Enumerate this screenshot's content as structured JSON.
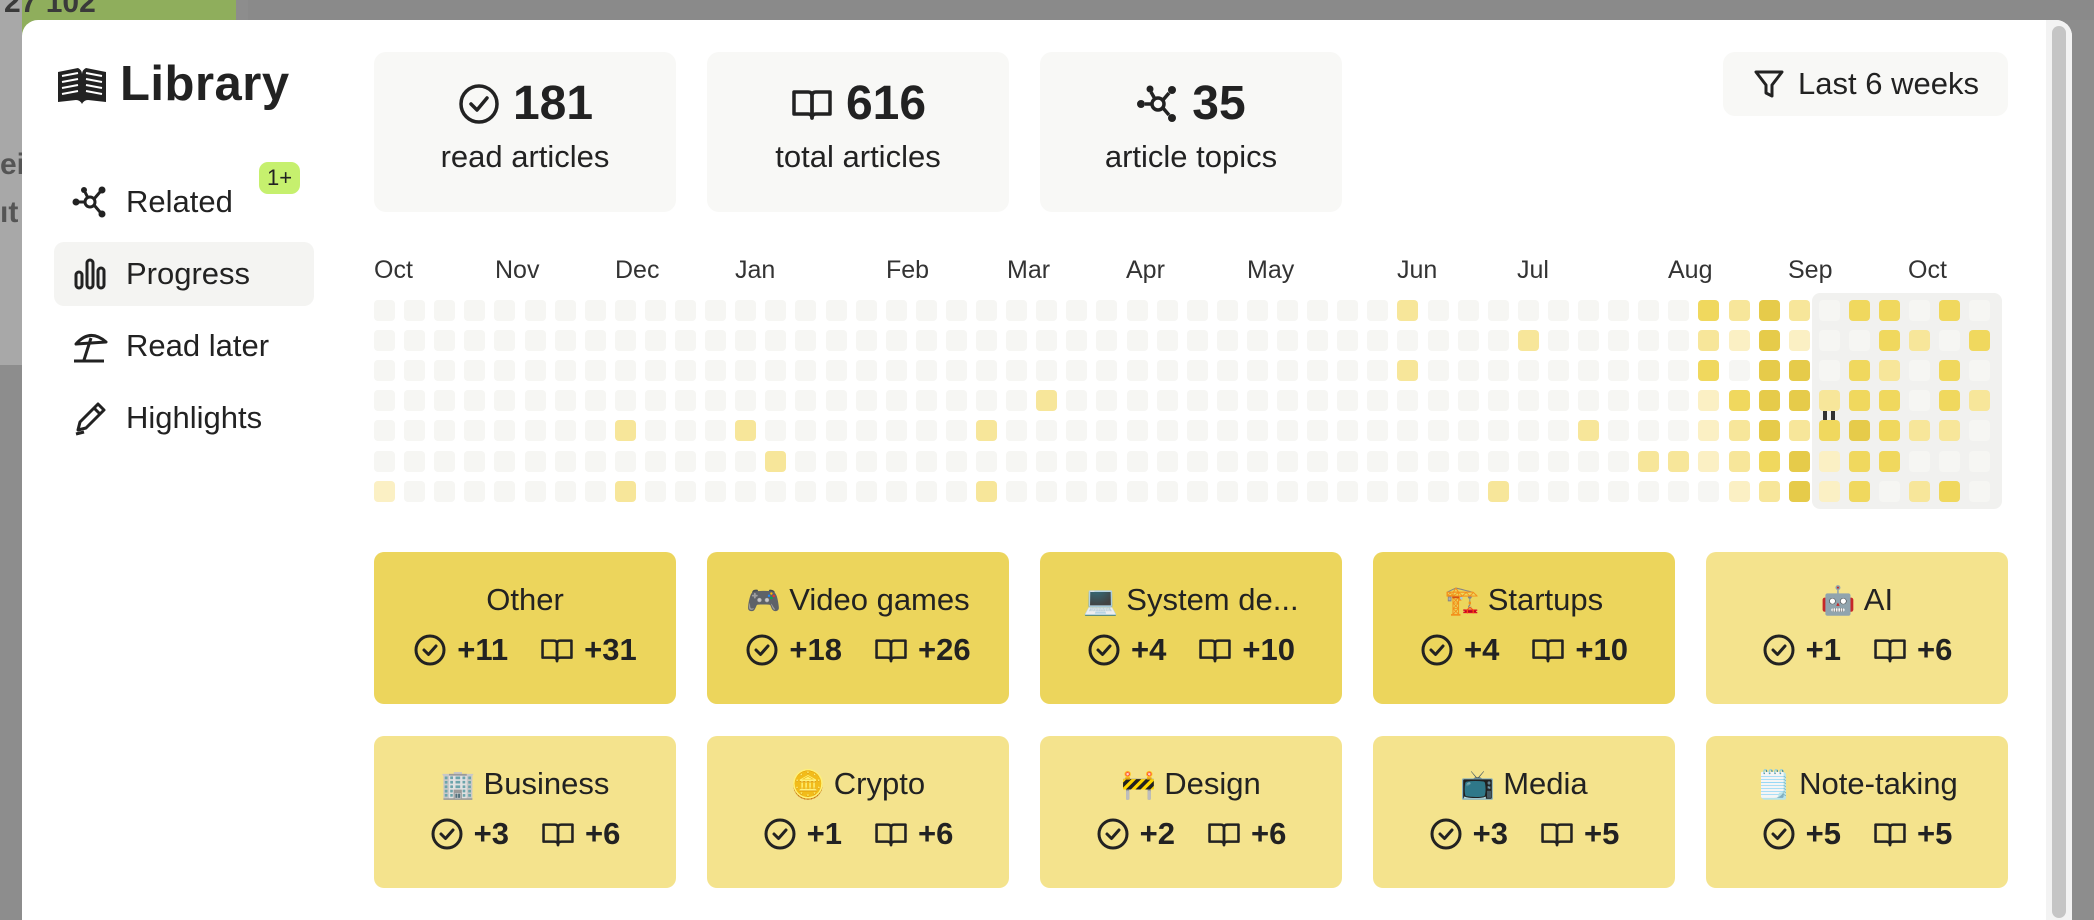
{
  "background": {
    "fragment_top": "27  102",
    "fragment_left_1": "ei",
    "fragment_left_2": "ıt"
  },
  "app": {
    "title": "Library"
  },
  "nav": {
    "items": [
      {
        "label": "Related",
        "icon": "graph-nodes-icon",
        "badge": "1+"
      },
      {
        "label": "Progress",
        "icon": "bar-chart-icon",
        "active": true
      },
      {
        "label": "Read later",
        "icon": "beach-umbrella-icon"
      },
      {
        "label": "Highlights",
        "icon": "pencil-icon"
      }
    ]
  },
  "stats": [
    {
      "value": "181",
      "label": "read articles",
      "icon": "check-circle-icon"
    },
    {
      "value": "616",
      "label": "total articles",
      "icon": "open-book-icon"
    },
    {
      "value": "35",
      "label": "article topics",
      "icon": "graph-nodes-icon"
    }
  ],
  "filter": {
    "label": "Last 6 weeks",
    "icon": "funnel-icon"
  },
  "heatmap": {
    "months": [
      "Oct",
      "Nov",
      "Dec",
      "Jan",
      "Feb",
      "Mar",
      "Apr",
      "May",
      "Jun",
      "Jul",
      "Aug",
      "Sep",
      "Oct"
    ],
    "colors": {
      "0": "#f6f6f3",
      "1": "#fbf0c4",
      "2": "#f7e69a",
      "3": "#f0d85e",
      "4": "#e6cb4a"
    },
    "weeks": 54,
    "selected_range": "last 6 weeks",
    "active_cells": [
      [
        34,
        0,
        2
      ],
      [
        0,
        6,
        1
      ],
      [
        8,
        4,
        2
      ],
      [
        8,
        6,
        2
      ],
      [
        12,
        4,
        2
      ],
      [
        13,
        5,
        2
      ],
      [
        20,
        4,
        2
      ],
      [
        20,
        6,
        2
      ],
      [
        22,
        3,
        2
      ],
      [
        34,
        2,
        2
      ],
      [
        37,
        6,
        2
      ],
      [
        38,
        1,
        2
      ],
      [
        40,
        4,
        2
      ],
      [
        42,
        5,
        2
      ],
      [
        43,
        5,
        2
      ],
      [
        44,
        0,
        3
      ],
      [
        44,
        1,
        2
      ],
      [
        44,
        2,
        3
      ],
      [
        44,
        3,
        1
      ],
      [
        44,
        4,
        1
      ],
      [
        44,
        5,
        1
      ],
      [
        45,
        0,
        2
      ],
      [
        45,
        1,
        1
      ],
      [
        45,
        3,
        3
      ],
      [
        45,
        4,
        2
      ],
      [
        45,
        5,
        2
      ],
      [
        45,
        6,
        1
      ],
      [
        46,
        0,
        4
      ],
      [
        46,
        1,
        4
      ],
      [
        46,
        2,
        4
      ],
      [
        46,
        3,
        4
      ],
      [
        46,
        4,
        4
      ],
      [
        46,
        5,
        3
      ],
      [
        46,
        6,
        2
      ],
      [
        47,
        0,
        2
      ],
      [
        47,
        1,
        1
      ],
      [
        47,
        2,
        4
      ],
      [
        47,
        3,
        4
      ],
      [
        47,
        4,
        2
      ],
      [
        47,
        5,
        4
      ],
      [
        47,
        6,
        4
      ],
      [
        48,
        3,
        2
      ],
      [
        48,
        4,
        3
      ],
      [
        48,
        5,
        1
      ],
      [
        48,
        6,
        1
      ],
      [
        49,
        0,
        3
      ],
      [
        49,
        2,
        3
      ],
      [
        49,
        3,
        3
      ],
      [
        49,
        4,
        4
      ],
      [
        49,
        5,
        3
      ],
      [
        49,
        6,
        3
      ],
      [
        50,
        0,
        3
      ],
      [
        50,
        1,
        3
      ],
      [
        50,
        2,
        2
      ],
      [
        50,
        3,
        3
      ],
      [
        50,
        4,
        3
      ],
      [
        50,
        5,
        3
      ],
      [
        51,
        1,
        2
      ],
      [
        51,
        4,
        2
      ],
      [
        51,
        6,
        2
      ],
      [
        52,
        0,
        3
      ],
      [
        52,
        2,
        3
      ],
      [
        52,
        3,
        3
      ],
      [
        52,
        4,
        2
      ],
      [
        52,
        6,
        3
      ],
      [
        53,
        1,
        3
      ],
      [
        53,
        3,
        2
      ],
      [
        54,
        1,
        3
      ],
      [
        55,
        1,
        2
      ]
    ]
  },
  "topics": [
    {
      "name": "Other",
      "emoji": "",
      "read": "+11",
      "total": "+31",
      "shade": "#ecd55c"
    },
    {
      "name": "Video games",
      "emoji": "🎮",
      "read": "+18",
      "total": "+26",
      "shade": "#ecd55c"
    },
    {
      "name": "System de...",
      "emoji": "💻",
      "read": "+4",
      "total": "+10",
      "shade": "#ecd55c"
    },
    {
      "name": "Startups",
      "emoji": "🏗️",
      "read": "+4",
      "total": "+10",
      "shade": "#ecd55c"
    },
    {
      "name": "AI",
      "emoji": "🤖",
      "read": "+1",
      "total": "+6",
      "shade": "#f4e38d"
    },
    {
      "name": "Business",
      "emoji": "🏢",
      "read": "+3",
      "total": "+6",
      "shade": "#f4e38d"
    },
    {
      "name": "Crypto",
      "emoji": "🪙",
      "read": "+1",
      "total": "+6",
      "shade": "#f4e38d"
    },
    {
      "name": "Design",
      "emoji": "🚧",
      "read": "+2",
      "total": "+6",
      "shade": "#f4e38d"
    },
    {
      "name": "Media",
      "emoji": "📺",
      "read": "+3",
      "total": "+5",
      "shade": "#f4e38d"
    },
    {
      "name": "Note-taking",
      "emoji": "🗒️",
      "read": "+5",
      "total": "+5",
      "shade": "#f4e38d"
    }
  ]
}
